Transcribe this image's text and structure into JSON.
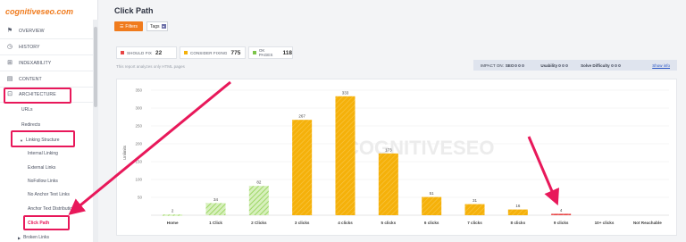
{
  "brand": "cognitiveseo.com",
  "sidebar": {
    "main_items": [
      {
        "label": "OVERVIEW",
        "icon": "flag-icon"
      },
      {
        "label": "HISTORY",
        "icon": "history-icon"
      },
      {
        "label": "INDEXABILITY",
        "icon": "indexability-icon"
      },
      {
        "label": "CONTENT",
        "icon": "content-icon"
      },
      {
        "label": "ARCHITECTURE",
        "icon": "architecture-icon"
      }
    ],
    "sub_items": [
      "URLs",
      "Redirects"
    ],
    "linking_structure": "Linking Structure",
    "linking_items": [
      "Internal Linking",
      "External Links",
      "NoFollow Links",
      "No Anchor Text Links",
      "Anchor Text Distributio",
      "Click Path"
    ],
    "broken_links": "Broken Links"
  },
  "header": {
    "title": "Click Path",
    "filters_label": "Filters",
    "tags_label": "Tags"
  },
  "stats": [
    {
      "label": "SHOULD FIX",
      "value": "22",
      "color": "#e84545"
    },
    {
      "label": "CONSIDER FIXING",
      "value": "775",
      "color": "#f5b10a"
    },
    {
      "label": "OK PAGES",
      "value": "118",
      "color": "#7cc44a"
    }
  ],
  "note": "This report analyzes only HTML pages",
  "impact": {
    "label": "IMPACT ON:",
    "seo": "SEO",
    "usability": "Usability",
    "solve": "Solve Difficulty",
    "show_info": "Show info"
  },
  "watermark": "COGNITIVESEO",
  "chart_data": {
    "type": "bar",
    "ylabel": "Unlimits",
    "ylim": [
      0,
      350
    ],
    "yticks": [
      50,
      100,
      150,
      200,
      250,
      300,
      350
    ],
    "categories": [
      "Home",
      "1 Click",
      "2 Clicks",
      "3 clicks",
      "4 clicks",
      "5 clicks",
      "6 clicks",
      "7 clicks",
      "8 clicks",
      "9 clicks",
      "10+ clicks",
      "Not Reachable"
    ],
    "values": [
      2,
      34,
      82,
      267,
      333,
      173,
      51,
      31,
      16,
      4,
      null,
      null
    ],
    "colors": [
      "#a6df72",
      "#a6df72",
      "#a6df72",
      "#f5b10a",
      "#f5b10a",
      "#f5b10a",
      "#f5b10a",
      "#f5b10a",
      "#f5b10a",
      "#e84545",
      null,
      null
    ],
    "grid": true
  }
}
